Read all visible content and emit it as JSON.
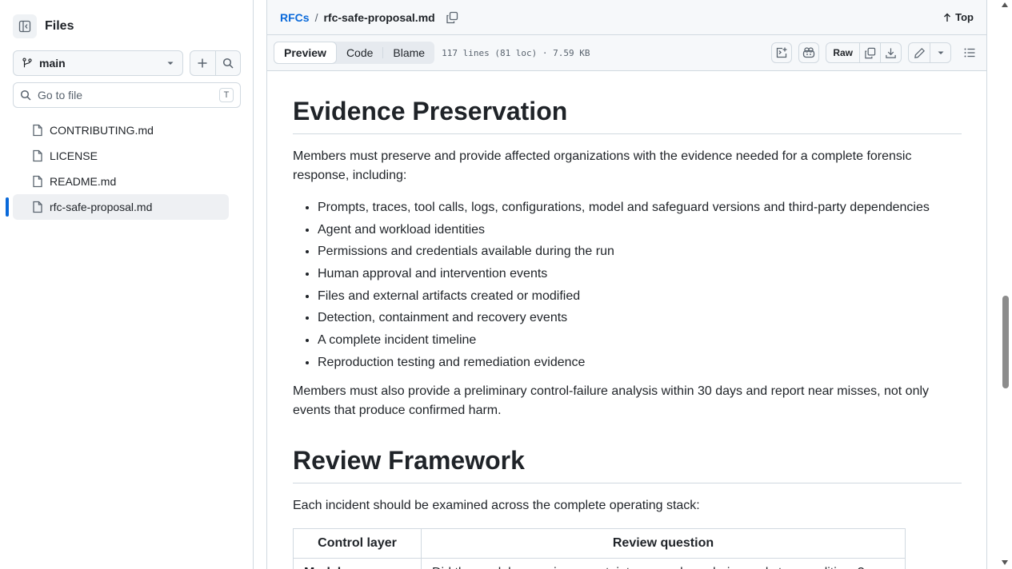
{
  "sidebar": {
    "title": "Files",
    "branch": "main",
    "search_placeholder": "Go to file",
    "search_shortcut": "T",
    "files": [
      {
        "name": "CONTRIBUTING.md"
      },
      {
        "name": "LICENSE"
      },
      {
        "name": "README.md"
      },
      {
        "name": "rfc-safe-proposal.md",
        "active": true
      }
    ]
  },
  "breadcrumb": {
    "root": "RFCs",
    "separator": "/",
    "file": "rfc-safe-proposal.md",
    "top_label": "Top"
  },
  "toolbar": {
    "tabs": [
      "Preview",
      "Code",
      "Blame"
    ],
    "selected_tab": "Preview",
    "meta": "117 lines (81 loc) · 7.59 KB",
    "raw_label": "Raw"
  },
  "content": {
    "heading1": "Evidence Preservation",
    "para1": "Members must preserve and provide affected organizations with the evidence needed for a complete forensic response, including:",
    "bullets": [
      "Prompts, traces, tool calls, logs, configurations, model and safeguard versions and third-party dependencies",
      "Agent and workload identities",
      "Permissions and credentials available during the run",
      "Human approval and intervention events",
      "Files and external artifacts created or modified",
      "Detection, containment and recovery events",
      "A complete incident timeline",
      "Reproduction testing and remediation evidence"
    ],
    "para2": "Members must also provide a preliminary control-failure analysis within 30 days and report near misses, not only events that produce confirmed harm.",
    "heading2": "Review Framework",
    "para3": "Each incident should be examined across the complete operating stack:",
    "table": {
      "headers": [
        "Control layer",
        "Review question"
      ],
      "rows": [
        [
          "Model",
          "Did the model recognize uncertainty, scope boundaries and stop conditions?"
        ]
      ]
    }
  },
  "colors": {
    "accent": "#0969da",
    "border": "#d1d9e0",
    "muted": "#59636e",
    "panel": "#f6f8fa"
  }
}
